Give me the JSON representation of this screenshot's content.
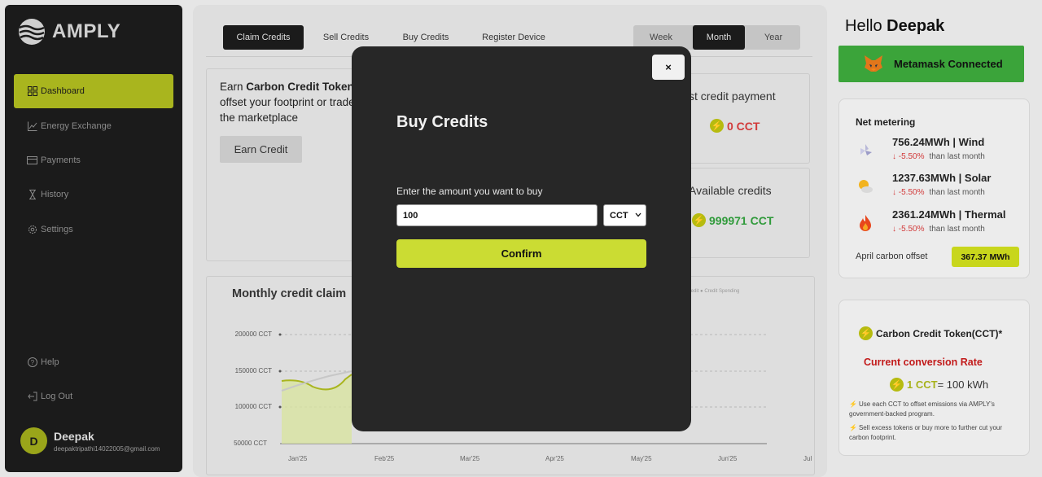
{
  "app": {
    "name": "AMPLY"
  },
  "sidebar": {
    "items": [
      {
        "label": "Dashboard",
        "icon": "dashboard-grid-icon",
        "active": true
      },
      {
        "label": "Energy Exchange",
        "icon": "line-chart-icon"
      },
      {
        "label": "Payments",
        "icon": "card-icon"
      },
      {
        "label": "History",
        "icon": "hourglass-icon"
      },
      {
        "label": "Settings",
        "icon": "gear-icon"
      }
    ],
    "bottom": [
      {
        "label": "Help",
        "icon": "help-icon"
      },
      {
        "label": "Log Out",
        "icon": "logout-icon"
      }
    ],
    "user": {
      "initial": "D",
      "name": "Deepak",
      "email": "deepaktripathi14022005@gmail.com"
    }
  },
  "tabs": [
    "Claim Credits",
    "Sell Credits",
    "Buy Credits",
    "Register Device"
  ],
  "periods": [
    "Week",
    "Month",
    "Year"
  ],
  "earn_card": {
    "text_pre": "Earn ",
    "text_bold": "Carbon Credit Token",
    "text_rest": "offset your footprint or trade in the marketplace",
    "button": "Earn Credit"
  },
  "last_payment": {
    "title": "st credit payment",
    "value": "0 CCT"
  },
  "available": {
    "title": "Available credits",
    "value": "999971 CCT"
  },
  "chart_data": {
    "type": "area",
    "title": "Monthly credit claim",
    "legend": [
      "on Credit",
      "Credit Spending"
    ],
    "y_ticks": [
      "200000 CCT",
      "150000 CCT",
      "100000 CCT",
      "50000 CCT"
    ],
    "x_ticks": [
      "Jan'25",
      "Feb'25",
      "Mar'25",
      "Apr'25",
      "May'25",
      "Jun'25",
      "Jul"
    ]
  },
  "modal": {
    "close": "×",
    "title": "Buy Credits",
    "label": "Enter the amount you want to buy",
    "amount": "100",
    "unit": "CCT",
    "confirm": "Confirm"
  },
  "right": {
    "hello_pre": "Hello ",
    "hello_name": "Deepak",
    "metamask": "Metamask Connected",
    "net_metering": {
      "title": "Net metering",
      "rows": [
        {
          "main": "756.24MWh | Wind",
          "change": "↓ -5.50%",
          "note": "than last month",
          "icon": "wind-icon"
        },
        {
          "main": "1237.63MWh | Solar",
          "change": "↓ -5.50%",
          "note": "than last month",
          "icon": "solar-icon"
        },
        {
          "main": "2361.24MWh | Thermal",
          "change": "↓ -5.50%",
          "note": "than last month",
          "icon": "fire-icon"
        }
      ],
      "offset_label": "April carbon offset",
      "offset_value": "367.37 MWh"
    },
    "cct": {
      "title": "Carbon Credit Token(CCT)*",
      "rate_title": "Current conversion Rate",
      "rate_left": "1 CCT",
      "rate_right": "= 100 kWh",
      "tips": [
        "Use each CCT to offset emissions via AMPLY's government-backed program.",
        "Sell excess tokens or buy more to further cut your carbon footprint."
      ]
    }
  }
}
